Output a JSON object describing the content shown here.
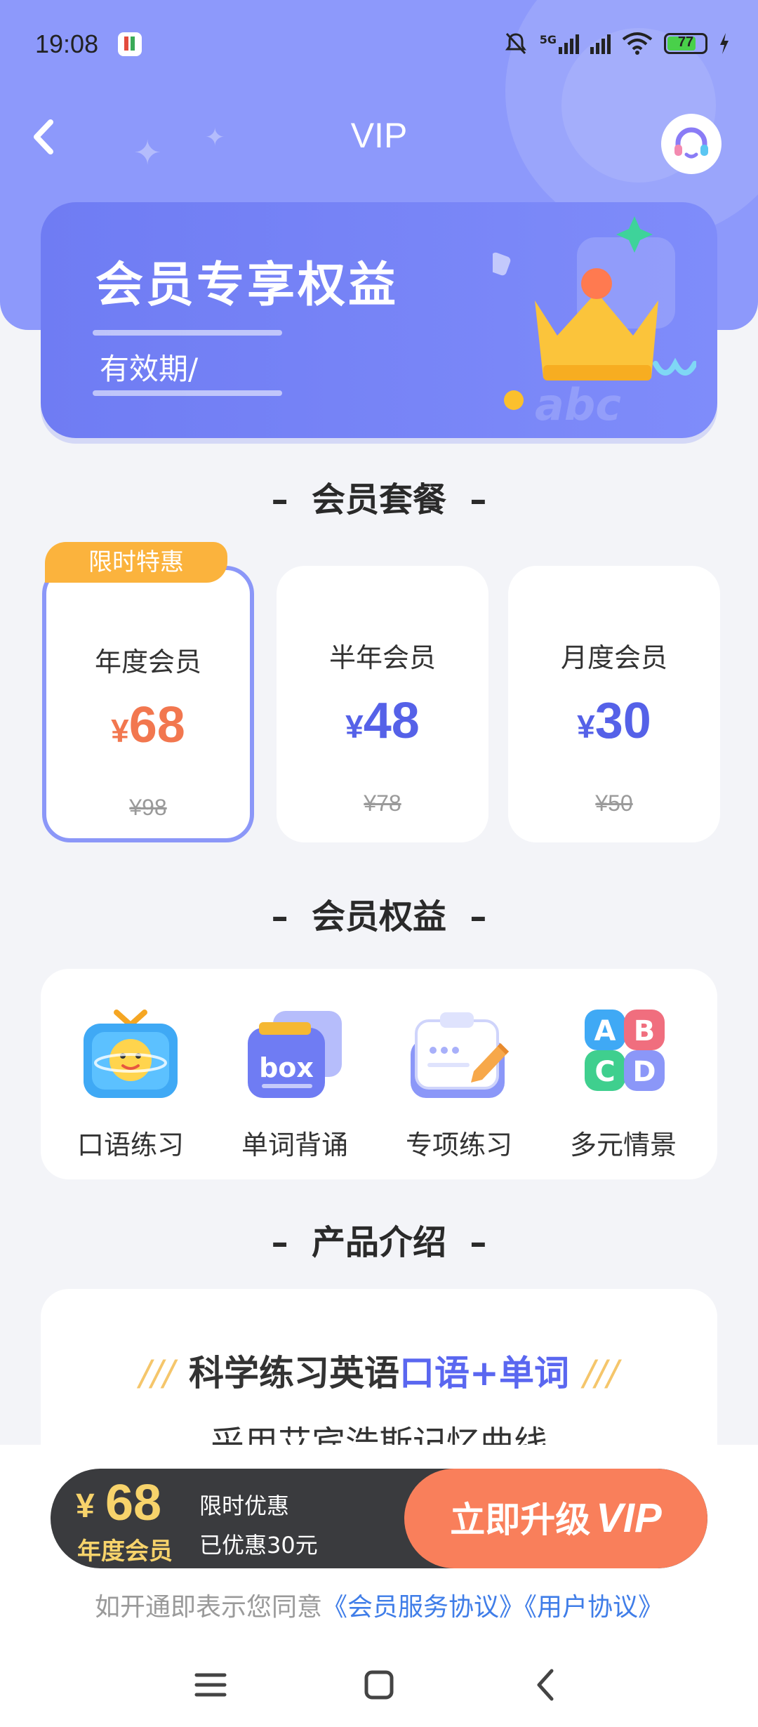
{
  "status_bar": {
    "time": "19:08",
    "network": "5G",
    "battery": "77"
  },
  "nav": {
    "back_icon": "chevron-left-icon",
    "title": "VIP",
    "service_icon": "headset-icon"
  },
  "banner": {
    "title": "会员专享权益",
    "validity": "有效期/"
  },
  "sections": {
    "plans": "会员套餐",
    "benefits": "会员权益",
    "intro": "产品介绍"
  },
  "plans": [
    {
      "tag": "限时特惠",
      "name": "年度会员",
      "currency": "¥",
      "price": "68",
      "original": "¥98",
      "selected": true
    },
    {
      "name": "半年会员",
      "currency": "¥",
      "price": "48",
      "original": "¥78",
      "selected": false
    },
    {
      "name": "月度会员",
      "currency": "¥",
      "price": "30",
      "original": "¥50",
      "selected": false
    }
  ],
  "benefits": [
    {
      "icon": "tv-icon",
      "label": "口语练习"
    },
    {
      "icon": "box-icon",
      "label": "单词背诵"
    },
    {
      "icon": "clipboard-icon",
      "label": "专项练习"
    },
    {
      "icon": "abcd-blocks-icon",
      "label": "多元情景"
    }
  ],
  "intro": {
    "headline_prefix": "科学练习英语",
    "headline_highlight": "口语+单词",
    "slashes": "///",
    "subline": "采用艾宾浩斯记忆曲线"
  },
  "buybar": {
    "currency": "¥",
    "price": "68",
    "plan": "年度会员",
    "promo_line1": "限时优惠",
    "promo_line2": "已优惠30元",
    "upgrade_label": "立即升级",
    "upgrade_vip": "VIP"
  },
  "agreement": {
    "prefix": "如开通即表示您同意",
    "link_service": "《会员服务协议》",
    "link_user": "《用户协议》"
  },
  "colors": {
    "accent": "#8d99fb",
    "price_selected": "#f2774f",
    "price": "#5561e8",
    "upgrade": "#f97f5b",
    "tag": "#fbb33d"
  }
}
